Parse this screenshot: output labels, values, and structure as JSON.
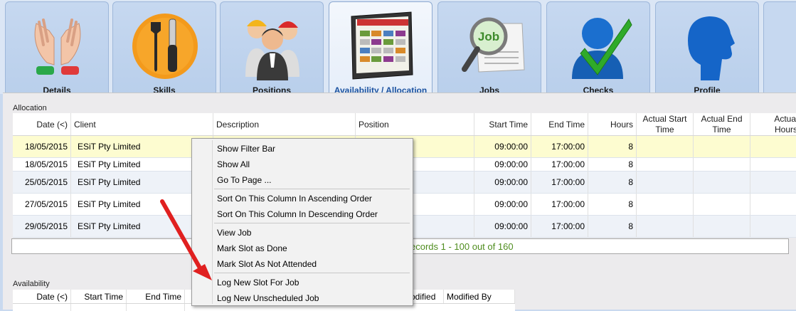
{
  "tabs": [
    {
      "label": "Details",
      "icon": "hands-icon"
    },
    {
      "label": "Skills",
      "icon": "tools-icon"
    },
    {
      "label": "Positions",
      "icon": "workers-icon"
    },
    {
      "label": "Availability / Allocation",
      "icon": "calendar-icon",
      "active": true
    },
    {
      "label": "Jobs",
      "icon": "job-search-icon"
    },
    {
      "label": "Checks",
      "icon": "checkmark-person-icon"
    },
    {
      "label": "Profile",
      "icon": "head-profile-icon"
    }
  ],
  "allocation": {
    "title": "Allocation",
    "columns": [
      "Date (<)",
      "Client",
      "Description",
      "Position",
      "Start Time",
      "End Time",
      "Hours",
      "Actual Start Time",
      "Actual End Time",
      "Actual Hours"
    ],
    "rows": [
      {
        "date": "18/05/2015",
        "client": "ESiT Pty Limited",
        "start": "09:00:00",
        "end": "17:00:00",
        "hours": "8"
      },
      {
        "date": "18/05/2015",
        "client": "ESiT Pty Limited",
        "start": "09:00:00",
        "end": "17:00:00",
        "hours": "8"
      },
      {
        "date": "25/05/2015",
        "client": "ESiT Pty Limited",
        "start": "09:00:00",
        "end": "17:00:00",
        "hours": "8"
      },
      {
        "date": "27/05/2015",
        "client": "ESiT Pty Limited",
        "start": "09:00:00",
        "end": "17:00:00",
        "hours": "8"
      },
      {
        "date": "29/05/2015",
        "client": "ESiT Pty Limited",
        "start": "09:00:00",
        "end": "17:00:00",
        "hours": "8"
      }
    ],
    "pager": "ecords 1 - 100 out of 160"
  },
  "availability": {
    "title": "Availability",
    "columns": [
      "Date (<)",
      "Start Time",
      "End Time",
      "odified",
      "Modified By"
    ]
  },
  "context_menu": {
    "items": [
      "Show Filter Bar",
      "Show All",
      "Go To Page ...",
      "Sort On This Column In Ascending Order",
      "Sort On This Column In Descending Order",
      "View Job",
      "Mark Slot as Done",
      "Mark Slot As Not Attended",
      "Log New Slot For Job",
      "Log New Unscheduled Job"
    ]
  },
  "colors": {
    "selected_row": "#fdfcd0",
    "pager_text": "#4f8d1f",
    "arrow": "#e02020",
    "active_tab_label": "#1b52a0"
  }
}
